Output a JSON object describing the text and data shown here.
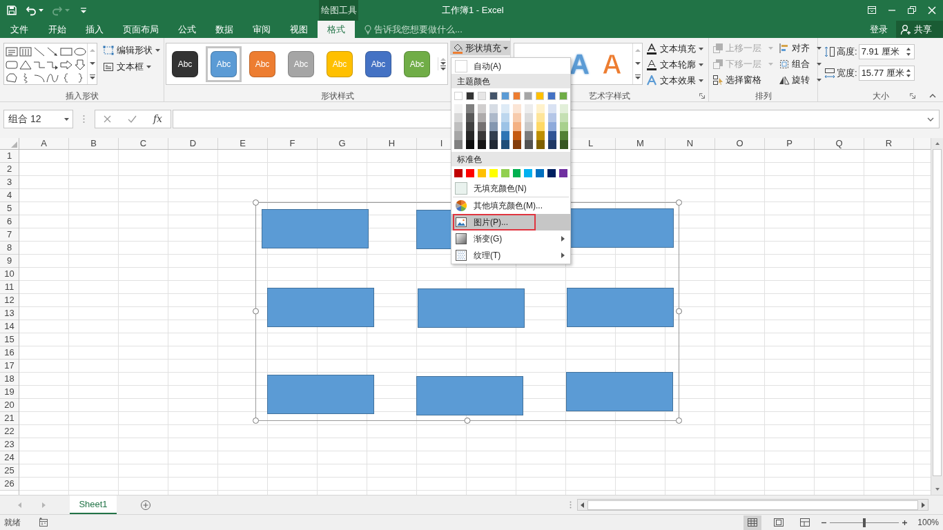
{
  "quick_access": [
    {
      "kind": "save",
      "disabled": false
    },
    {
      "kind": "undo",
      "disabled": false
    },
    {
      "kind": "redo",
      "disabled": true
    },
    {
      "kind": "customize",
      "disabled": false
    }
  ],
  "context_tab_group": "绘图工具",
  "window_title": "工作簿1 - Excel",
  "tabs": [
    {
      "label": "文件",
      "selected": false
    },
    {
      "label": "开始",
      "selected": false
    },
    {
      "label": "插入",
      "selected": false
    },
    {
      "label": "页面布局",
      "selected": false
    },
    {
      "label": "公式",
      "selected": false
    },
    {
      "label": "数据",
      "selected": false
    },
    {
      "label": "审阅",
      "selected": false
    },
    {
      "label": "视图",
      "selected": false
    },
    {
      "label": "格式",
      "selected": true
    }
  ],
  "tell_me": {
    "placeholder": "告诉我您想要做什么..."
  },
  "account": {
    "sign_in": "登录",
    "share": "共享"
  },
  "ribbon": {
    "insert_shapes": {
      "label": "插入形状",
      "buttons": [
        {
          "label": "编辑形状",
          "kind": "edit_shape"
        },
        {
          "label": "文本框",
          "kind": "text_box"
        }
      ]
    },
    "shape_styles": {
      "label": "形状样式",
      "styles": [
        {
          "text": "Abc",
          "color": "#333333",
          "selected": false
        },
        {
          "text": "Abc",
          "color": "#5b9bd5",
          "selected": true
        },
        {
          "text": "Abc",
          "color": "#ed7d31",
          "selected": false
        },
        {
          "text": "Abc",
          "color": "#a5a5a5",
          "selected": false
        },
        {
          "text": "Abc",
          "color": "#ffc000",
          "selected": false
        },
        {
          "text": "Abc",
          "color": "#4472c4",
          "selected": false
        },
        {
          "text": "Abc",
          "color": "#70ad47",
          "selected": false
        }
      ],
      "fill_button": {
        "label": "形状填充",
        "pressed": true
      }
    },
    "wordart_styles": {
      "label": "艺术字样式",
      "letters": [
        {
          "text": "A",
          "kind": "filled",
          "color": "#5b9bd5"
        },
        {
          "text": "A",
          "kind": "outlined",
          "color": "#ed7d31"
        }
      ],
      "buttons": [
        {
          "label": "文本填充",
          "kind": "text_fill"
        },
        {
          "label": "文本轮廓",
          "kind": "text_outline"
        },
        {
          "label": "文本效果",
          "kind": "text_effects"
        }
      ]
    },
    "arrange": {
      "label": "排列",
      "buttons": [
        {
          "label": "上移一层",
          "kind": "bring_forward",
          "disabled": true,
          "dropdown": true
        },
        {
          "label": "下移一层",
          "kind": "send_backward",
          "disabled": true,
          "dropdown": true
        },
        {
          "label": "选择窗格",
          "kind": "selection_pane",
          "disabled": false,
          "dropdown": false
        },
        {
          "label": "对齐",
          "kind": "align",
          "disabled": false,
          "dropdown": true
        },
        {
          "label": "组合",
          "kind": "group",
          "disabled": false,
          "dropdown": true
        },
        {
          "label": "旋转",
          "kind": "rotate",
          "disabled": false,
          "dropdown": true
        }
      ]
    },
    "size": {
      "label": "大小",
      "fields": [
        {
          "kind": "height",
          "label": "高度:",
          "value": "7.91 厘米"
        },
        {
          "kind": "width",
          "label": "宽度:",
          "value": "15.77 厘米"
        }
      ]
    }
  },
  "formula_bar": {
    "name_box": "组合 12",
    "function_button": "fx"
  },
  "columns_left": [
    "A",
    "B",
    "C",
    "D",
    "E",
    "F",
    "G",
    "H",
    "I"
  ],
  "columns_right": [
    "L",
    "M",
    "N",
    "O",
    "P",
    "Q",
    "R"
  ],
  "rows": [
    "1",
    "2",
    "3",
    "4",
    "5",
    "6",
    "7",
    "8",
    "9",
    "10",
    "11",
    "12",
    "13",
    "14",
    "15",
    "16",
    "17",
    "18",
    "19",
    "20",
    "21",
    "22",
    "23",
    "24",
    "25",
    "26"
  ],
  "drawing_group": {
    "selected": true
  },
  "fill_menu": {
    "auto": {
      "label": "自动(A)"
    },
    "theme_header": "主题颜色",
    "theme_colors": [
      {
        "color": "#ffffff",
        "shades": [
          {
            "color": "#f2f2f2"
          },
          {
            "color": "#d9d9d9"
          },
          {
            "color": "#bfbfbf"
          },
          {
            "color": "#a6a6a6"
          },
          {
            "color": "#808080"
          }
        ]
      },
      {
        "color": "#333333",
        "shades": [
          {
            "color": "#808080"
          },
          {
            "color": "#595959"
          },
          {
            "color": "#404040"
          },
          {
            "color": "#262626"
          },
          {
            "color": "#0d0d0d"
          }
        ]
      },
      {
        "color": "#e7e6e6",
        "shades": [
          {
            "color": "#d0cece"
          },
          {
            "color": "#aeabab"
          },
          {
            "color": "#757171"
          },
          {
            "color": "#3a3838"
          },
          {
            "color": "#171616"
          }
        ]
      },
      {
        "color": "#44546a",
        "shades": [
          {
            "color": "#d6dce4"
          },
          {
            "color": "#adb9ca"
          },
          {
            "color": "#8497b0"
          },
          {
            "color": "#333f4f"
          },
          {
            "color": "#222a35"
          }
        ]
      },
      {
        "color": "#5b9bd5",
        "shades": [
          {
            "color": "#deebf6"
          },
          {
            "color": "#bdd7ee"
          },
          {
            "color": "#9dc3e6"
          },
          {
            "color": "#2e75b5"
          },
          {
            "color": "#1f4e79"
          }
        ]
      },
      {
        "color": "#ed7d31",
        "shades": [
          {
            "color": "#fbe5d5"
          },
          {
            "color": "#f7cbac"
          },
          {
            "color": "#f4b183"
          },
          {
            "color": "#c55a11"
          },
          {
            "color": "#833c0b"
          }
        ]
      },
      {
        "color": "#a5a5a5",
        "shades": [
          {
            "color": "#ededed"
          },
          {
            "color": "#dbdbdb"
          },
          {
            "color": "#c9c9c9"
          },
          {
            "color": "#7b7b7b"
          },
          {
            "color": "#525252"
          }
        ]
      },
      {
        "color": "#ffc000",
        "shades": [
          {
            "color": "#fff2cc"
          },
          {
            "color": "#fee599"
          },
          {
            "color": "#ffd965"
          },
          {
            "color": "#bf9000"
          },
          {
            "color": "#7f6000"
          }
        ]
      },
      {
        "color": "#4472c4",
        "shades": [
          {
            "color": "#d9e2f3"
          },
          {
            "color": "#b4c6e7"
          },
          {
            "color": "#8eaadb"
          },
          {
            "color": "#2f5496"
          },
          {
            "color": "#1f3864"
          }
        ]
      },
      {
        "color": "#70ad47",
        "shades": [
          {
            "color": "#e2efd9"
          },
          {
            "color": "#c5e0b3"
          },
          {
            "color": "#a8d08d"
          },
          {
            "color": "#538135"
          },
          {
            "color": "#375623"
          }
        ]
      }
    ],
    "standard_header": "标准色",
    "standard_colors": [
      {
        "color": "#c00000"
      },
      {
        "color": "#ff0000"
      },
      {
        "color": "#ffc000"
      },
      {
        "color": "#ffff00"
      },
      {
        "color": "#92d050"
      },
      {
        "color": "#00b050"
      },
      {
        "color": "#00b0f0"
      },
      {
        "color": "#0070c0"
      },
      {
        "color": "#002060"
      },
      {
        "color": "#7030a0"
      }
    ],
    "items": [
      {
        "kind": "no_fill",
        "label": "无填充颜色(N)",
        "submenu": false,
        "highlighted": false,
        "outlined": false
      },
      {
        "kind": "more_colors",
        "label": "其他填充颜色(M)...",
        "submenu": false,
        "highlighted": false,
        "outlined": false
      },
      {
        "kind": "picture",
        "label": "图片(P)...",
        "submenu": false,
        "highlighted": true,
        "outlined": true
      },
      {
        "kind": "gradient",
        "label": "渐变(G)",
        "submenu": true,
        "highlighted": false,
        "outlined": false
      },
      {
        "kind": "texture",
        "label": "纹理(T)",
        "submenu": true,
        "highlighted": false,
        "outlined": false
      }
    ]
  },
  "sheet_tabs": [
    {
      "label": "Sheet1",
      "selected": true
    }
  ],
  "status_bar": {
    "text": "就绪",
    "views": [
      {
        "kind": "normal",
        "selected": true
      },
      {
        "kind": "page_layout",
        "selected": false
      },
      {
        "kind": "page_break",
        "selected": false
      }
    ],
    "zoom": {
      "level": 0.5,
      "reading": "100%"
    }
  }
}
